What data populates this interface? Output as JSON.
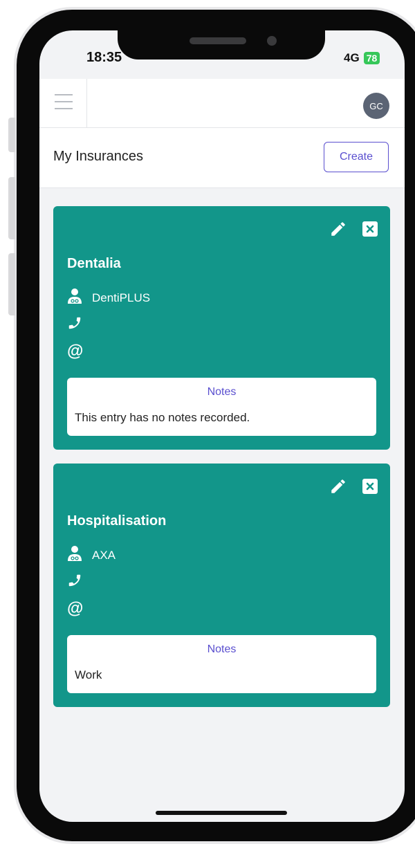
{
  "status_bar": {
    "time": "18:35",
    "network": "4G",
    "battery": "78"
  },
  "header": {
    "avatar_initials": "GC"
  },
  "page": {
    "title": "My Insurances",
    "create_label": "Create"
  },
  "cards": [
    {
      "title": "Dentalia",
      "provider": "DentiPLUS",
      "phone": "",
      "email": "",
      "notes_label": "Notes",
      "notes_text": "This entry has no notes recorded."
    },
    {
      "title": "Hospitalisation",
      "provider": "AXA",
      "phone": "",
      "email": "",
      "notes_label": "Notes",
      "notes_text": "Work"
    }
  ],
  "colors": {
    "card_bg": "#12968a",
    "accent": "#5a4fcf",
    "screen_bg": "#f2f3f5"
  },
  "icons": {
    "menu": "hamburger-icon",
    "edit": "pencil-icon",
    "delete": "close-square-icon",
    "provider": "user-doctor-icon",
    "phone": "phone-icon",
    "email": "at-icon"
  }
}
